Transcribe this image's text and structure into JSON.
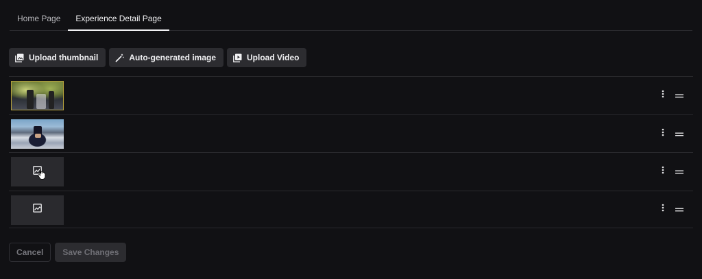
{
  "tabs": [
    {
      "label": "Home Page",
      "active": false
    },
    {
      "label": "Experience Detail Page",
      "active": true
    }
  ],
  "toolbar": {
    "upload_thumbnail": "Upload thumbnail",
    "auto_generated": "Auto-generated image",
    "upload_video": "Upload Video"
  },
  "media_rows": [
    {
      "kind": "photo",
      "icon": "image-thumbnail"
    },
    {
      "kind": "photo",
      "icon": "image-thumbnail"
    },
    {
      "kind": "placeholder",
      "icon": "image-placeholder-icon"
    },
    {
      "kind": "placeholder",
      "icon": "image-placeholder-icon"
    }
  ],
  "footer": {
    "cancel": "Cancel",
    "save": "Save Changes"
  },
  "colors": {
    "background": "#111114",
    "button_bg": "#2c2c30",
    "divider": "#2a2a2e"
  }
}
